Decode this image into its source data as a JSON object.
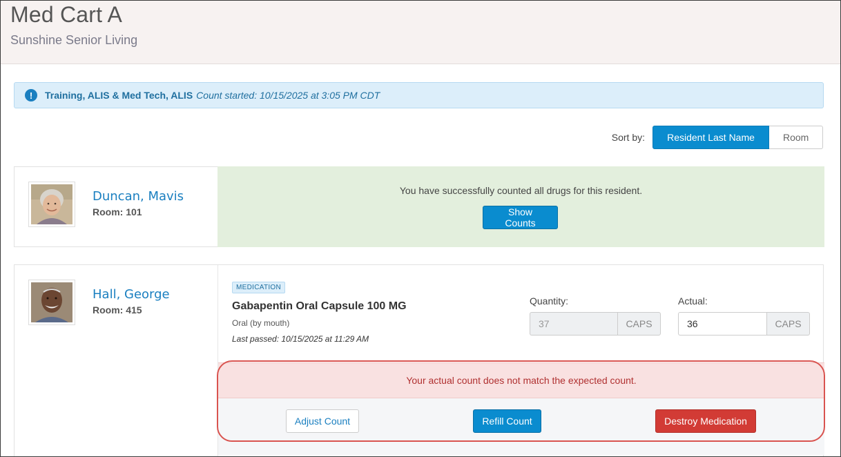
{
  "header": {
    "title": "Med Cart A",
    "subtitle": "Sunshine Senior Living"
  },
  "alert": {
    "icon": "exclamation-circle-icon",
    "user": "Training, ALIS & Med Tech, ALIS",
    "status": "Count started: 10/15/2025 at 3:05 PM CDT",
    "color": "#1a7fc0"
  },
  "sort": {
    "label": "Sort by:",
    "options": [
      "Resident Last Name",
      "Room"
    ],
    "selected": "Resident Last Name",
    "accent": "#0a8ccf"
  },
  "residents": [
    {
      "name": "Duncan, Mavis",
      "room": "Room: 101",
      "status_message": "You have successfully counted all drugs for this resident.",
      "show_counts_label": "Show Counts",
      "panel_color": "#e3efdd"
    },
    {
      "name": "Hall, George",
      "room": "Room: 415",
      "medication": {
        "badge": "MEDICATION",
        "name": "Gabapentin Oral Capsule 100 MG",
        "route": "Oral (by mouth)",
        "last_passed": "Last passed: 10/15/2025 at 11:29 AM",
        "quantity_label": "Quantity:",
        "quantity_value": "37",
        "quantity_unit": "CAPS",
        "actual_label": "Actual:",
        "actual_value": "36",
        "actual_unit": "CAPS",
        "mismatch_message": "Your actual count does not match the expected count.",
        "actions": {
          "adjust": "Adjust Count",
          "refill": "Refill Count",
          "destroy": "Destroy Medication"
        },
        "danger_color": "#d23b35"
      }
    }
  ]
}
